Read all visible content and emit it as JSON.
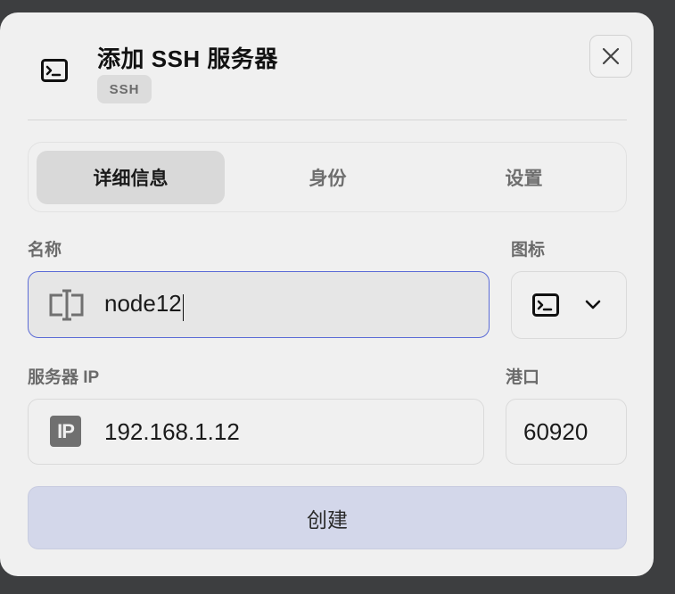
{
  "dialog": {
    "title": "添加 SSH 服务器",
    "badge": "SSH",
    "close_icon": "close-icon",
    "header_icon": "terminal-icon"
  },
  "tabs": [
    {
      "label": "详细信息",
      "active": true
    },
    {
      "label": "身份",
      "active": false
    },
    {
      "label": "设置",
      "active": false
    }
  ],
  "form": {
    "name": {
      "label": "名称",
      "value": "node12",
      "icon": "text-cursor-icon"
    },
    "icon_picker": {
      "label": "图标",
      "selected_icon": "terminal-icon",
      "dropdown_icon": "chevron-down-icon"
    },
    "server_ip": {
      "label": "服务器 IP",
      "value": "192.168.1.12",
      "icon": "ip-icon",
      "icon_text": "IP"
    },
    "port": {
      "label": "港口",
      "value": "60920"
    }
  },
  "actions": {
    "create_label": "创建"
  },
  "colors": {
    "focus_border": "#5b6bd6",
    "primary_button": "#d3d7ea",
    "dialog_bg": "#f0f0f0"
  }
}
